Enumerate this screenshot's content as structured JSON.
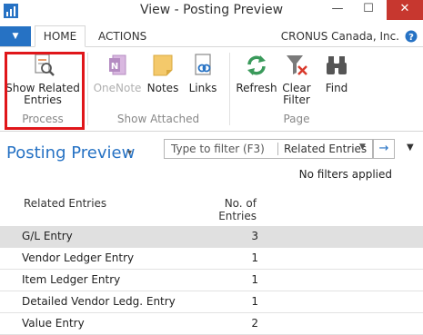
{
  "window": {
    "title": "View - Posting Preview",
    "min_glyph": "—",
    "max_glyph": "☐",
    "close_glyph": "✕"
  },
  "tabs": {
    "file_glyph": "▼",
    "home": "HOME",
    "actions": "ACTIONS",
    "company": "CRONUS Canada, Inc.",
    "help_glyph": "?"
  },
  "ribbon": {
    "show_related_entries": "Show Related Entries",
    "process_group": "Process",
    "onenote": "OneNote",
    "notes": "Notes",
    "links": "Links",
    "show_attached_group": "Show Attached",
    "refresh": "Refresh",
    "clear_filter": "Clear Filter",
    "find": "Find",
    "page_group": "Page"
  },
  "page": {
    "title": "Posting Preview",
    "title_caret": "▾",
    "filter_placeholder": "Type to filter (F3)",
    "filter_field": "Related Entries",
    "filter_caret": "▼",
    "go_glyph": "→",
    "expand_caret": "▼",
    "no_filters": "No filters applied"
  },
  "table": {
    "columns": [
      "Related Entries",
      "No. of Entries"
    ],
    "rows": [
      {
        "name": "G/L Entry",
        "count": "3",
        "selected": true
      },
      {
        "name": "Vendor Ledger Entry",
        "count": "1"
      },
      {
        "name": "Item Ledger Entry",
        "count": "1"
      },
      {
        "name": "Detailed Vendor Ledg. Entry",
        "count": "1"
      },
      {
        "name": "Value Entry",
        "count": "2"
      }
    ]
  },
  "colors": {
    "accent": "#2672c4",
    "highlight_border": "#e0161a",
    "selected_row": "#e0e0e0"
  }
}
